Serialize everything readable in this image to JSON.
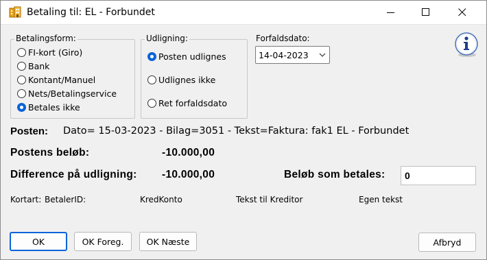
{
  "window": {
    "title": "Betaling til: EL - Forbundet",
    "icon": "building-app-icon"
  },
  "betalingsform": {
    "label": "Betalingsform:",
    "options": [
      {
        "label": "FI-kort (Giro)",
        "checked": false
      },
      {
        "label": "Bank",
        "checked": false
      },
      {
        "label": "Kontant/Manuel",
        "checked": false
      },
      {
        "label": "Nets/Betalingservice",
        "checked": false
      },
      {
        "label": "Betales ikke",
        "checked": true
      }
    ]
  },
  "udligning": {
    "label": "Udligning:",
    "options": [
      {
        "label": "Posten udlignes",
        "checked": true
      },
      {
        "label": "Udlignes ikke",
        "checked": false
      },
      {
        "label": "Ret forfaldsdato",
        "checked": false
      }
    ]
  },
  "forfaldsdato": {
    "label": "Forfaldsdato:",
    "value": "14-04-2023"
  },
  "posten": {
    "label": "Posten:",
    "text": "Dato= 15-03-2023  -  Bilag=3051  -  Tekst=Faktura: fak1 EL - Forbundet"
  },
  "postens_beloeb": {
    "label": "Postens beløb:",
    "value": "-10.000,00"
  },
  "difference": {
    "label": "Difference på udligning:",
    "value": "-10.000,00"
  },
  "beloeb_som_betales": {
    "label": "Beløb som betales:",
    "value": "0"
  },
  "fields": {
    "kortart": "Kortart:",
    "betaler_id": "BetalerID:",
    "kred_konto": "KredKonto",
    "tekst_til_kreditor": "Tekst til Kreditor",
    "egen_tekst": "Egen tekst"
  },
  "buttons": {
    "ok": "OK",
    "ok_foreg": "OK Foreg.",
    "ok_naeste": "OK Næste",
    "afbryd": "Afbryd"
  },
  "colors": {
    "accent": "#0a64d8",
    "background": "#f0f0f0",
    "titlebar": "#ffffff"
  }
}
